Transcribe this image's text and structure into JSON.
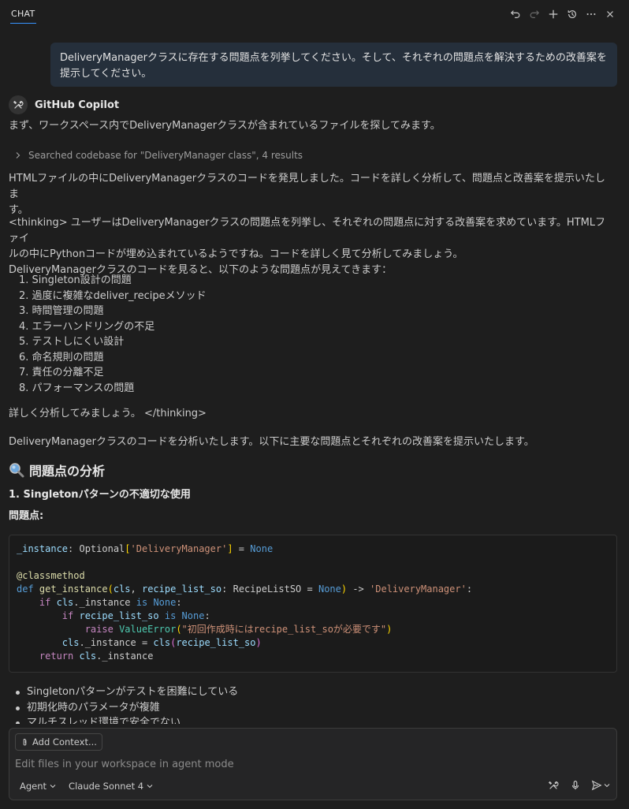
{
  "header": {
    "tab_label": "CHAT"
  },
  "user_message": {
    "line1": "DeliveryManagerクラスに存在する問題点を列挙してください。そして、それぞれの問題点を解決するための改善案を",
    "line2": "提示してください。"
  },
  "agent": {
    "name": "GitHub Copilot",
    "intro": "まず、ワークスペース内でDeliveryManagerクラスが含まれているファイルを探してみます。",
    "search_result": "Searched codebase for \"DeliveryManager class\", 4 results",
    "found_line1": "HTMLファイルの中にDeliveryManagerクラスのコードを発見しました。コードを詳しく分析して、問題点と改善案を提示いたしま",
    "found_line2": "す。",
    "thinking_line1": "<thinking> ユーザーはDeliveryManagerクラスの問題点を列挙し、それぞれの問題点に対する改善案を求めています。HTMLファイ",
    "thinking_line2": "ルの中にPythonコードが埋め込まれているようですね。コードを詳しく見て分析してみましょう。",
    "thinking_line3": "DeliveryManagerクラスのコードを見ると、以下のような問題点が見えてきます：",
    "issues": [
      "1. Singleton設計の問題",
      "2. 過度に複雑なdeliver_recipeメソッド",
      "3. 時間管理の問題",
      "4. エラーハンドリングの不足",
      "5. テストしにくい設計",
      "6. 命名規則の問題",
      "7. 責任の分離不足",
      "8. パフォーマンスの問題"
    ],
    "thinking_end": "詳しく分析してみましょう。 </thinking>",
    "summary": "DeliveryManagerクラスのコードを分析いたします。以下に主要な問題点とそれぞれの改善案を提示いたします。",
    "section_title": "問題点の分析",
    "subsection_title": "1. Singletonパターンの不適切な使用",
    "problems_label": "問題点:",
    "bullets": [
      "Singletonパターンがテストを困難にしている",
      "初期化時のパラメータが複雑",
      "マルチスレッド環境で安全でない"
    ]
  },
  "code": {
    "l1_a": "_instance",
    "l1_b": ": Optional",
    "l1_c": "[",
    "l1_d": "'DeliveryManager'",
    "l1_e": "]",
    "l1_f": " = ",
    "l1_g": "None",
    "l3": "@classmethod",
    "l4_def": "def ",
    "l4_fn": "get_instance",
    "l4_p1": "(",
    "l4_cls": "cls",
    "l4_sep": ", ",
    "l4_arg": "recipe_list_so",
    "l4_type": ": RecipeListSO = ",
    "l4_none": "None",
    "l4_p2": ")",
    "l4_arrow": " -> ",
    "l4_ret": "'DeliveryManager'",
    "l4_colon": ":",
    "l5_if": "if ",
    "l5_cls": "cls",
    "l5_attr": "._instance ",
    "l5_is": "is ",
    "l5_none": "None",
    "l5_colon": ":",
    "l6_if": "if ",
    "l6_arg": "recipe_list_so ",
    "l6_is": "is ",
    "l6_none": "None",
    "l6_colon": ":",
    "l7_raise": "raise ",
    "l7_err": "ValueError",
    "l7_p1": "(",
    "l7_str": "\"初回作成時にはrecipe_list_soが必要です\"",
    "l7_p2": ")",
    "l8_cls": "cls",
    "l8_attr": "._instance = ",
    "l8_cls2": "cls",
    "l8_p1": "(",
    "l8_arg": "recipe_list_so",
    "l8_p2": ")",
    "l9_ret": "return ",
    "l9_cls": "cls",
    "l9_attr": "._instance"
  },
  "input": {
    "add_context": "Add Context...",
    "placeholder": "Edit files in your workspace in agent mode",
    "mode": "Agent",
    "model": "Claude Sonnet 4"
  },
  "icons": {
    "undo": "undo-icon",
    "redo": "redo-icon",
    "new": "plus-icon",
    "history": "history-icon",
    "more": "ellipsis-icon",
    "close": "close-icon",
    "tools": "tools-icon",
    "mic": "microphone-icon",
    "send": "send-icon"
  }
}
